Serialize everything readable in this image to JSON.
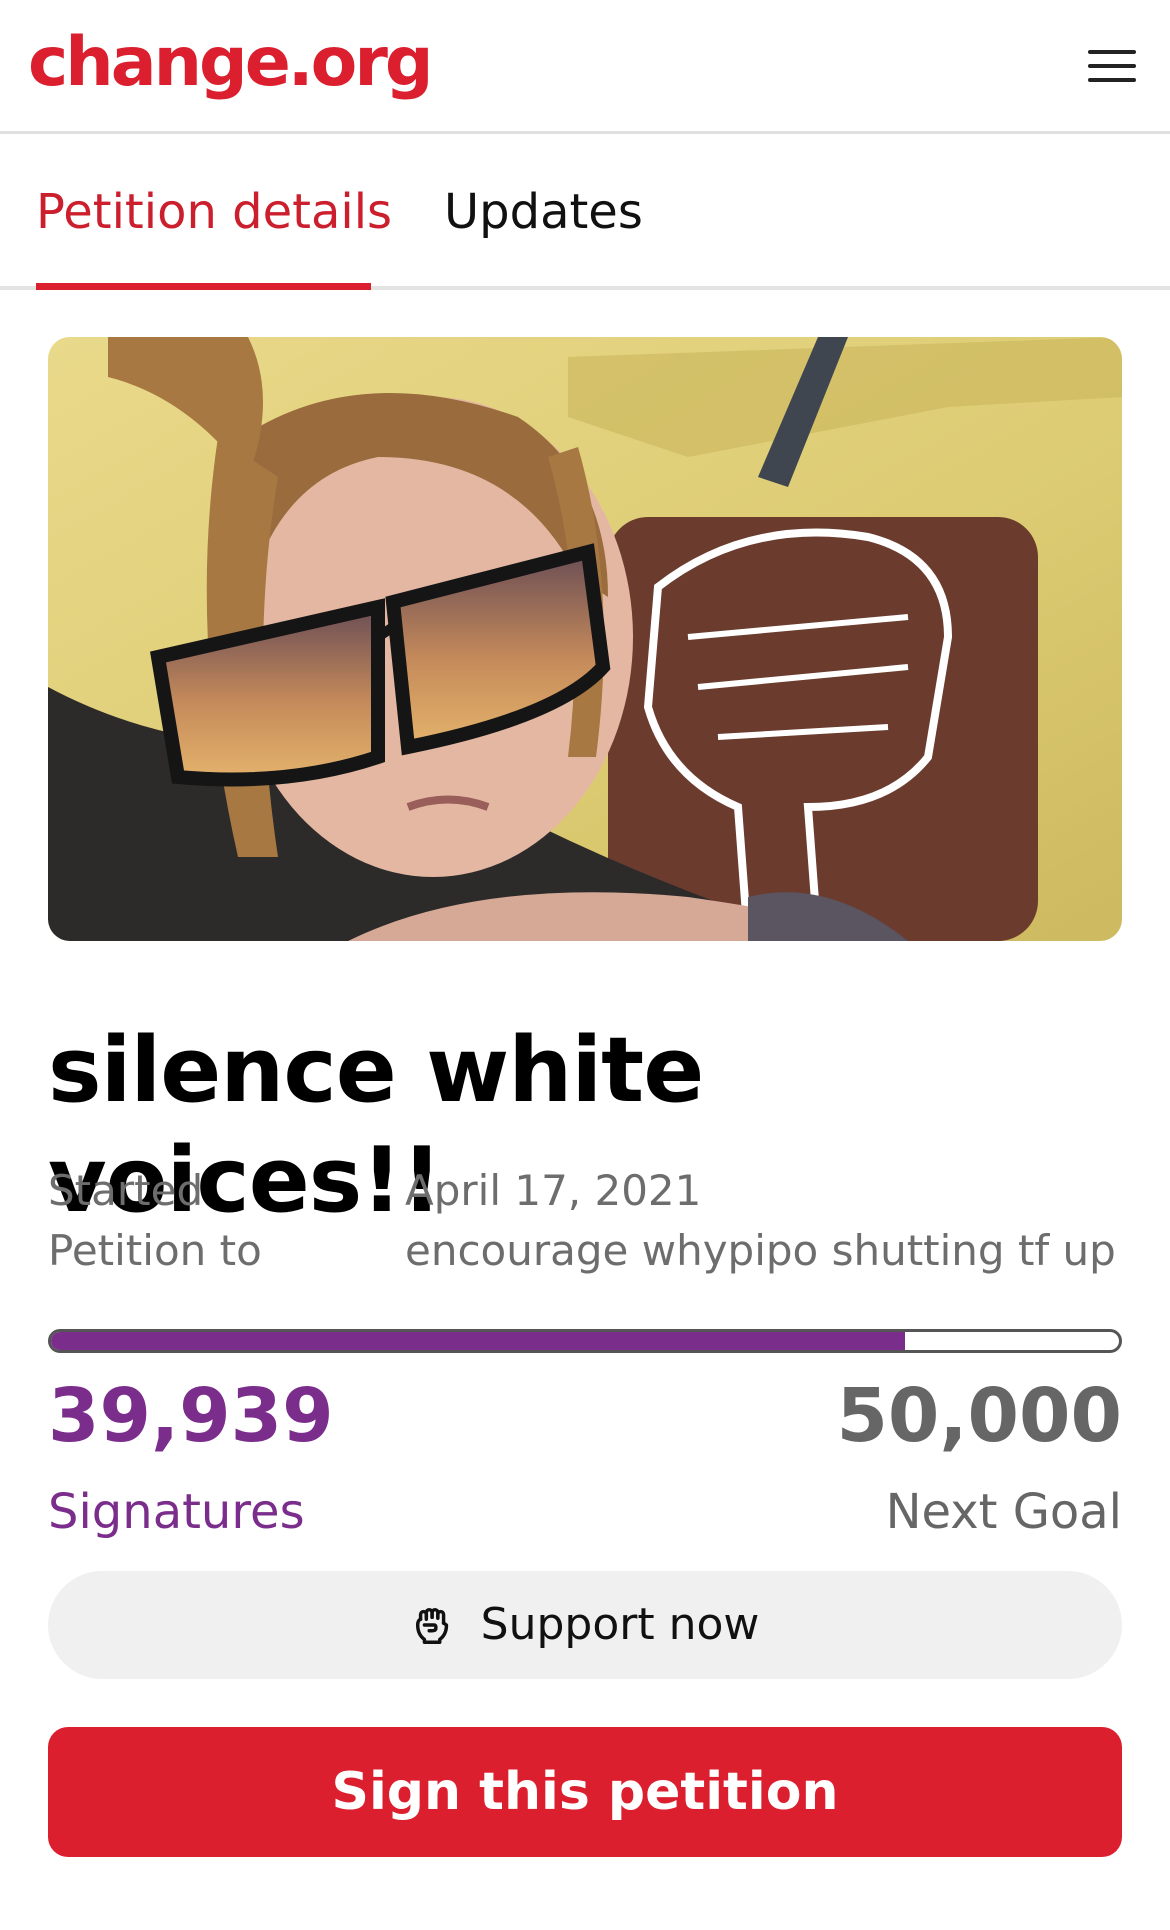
{
  "header": {
    "logo_text": "change.org",
    "menu_icon": "hamburger-menu-icon"
  },
  "tabs": [
    {
      "label": "Petition details",
      "active": true
    },
    {
      "label": "Updates",
      "active": false
    }
  ],
  "petition": {
    "title": "silence white voices!!",
    "started_label": "Started",
    "started_value": "April 17, 2021",
    "petition_to_label": "Petition to",
    "petition_to_value": "encourage whypipo shutting tf up"
  },
  "progress": {
    "signatures": "39,939",
    "signatures_label": "Signatures",
    "goal": "50,000",
    "goal_label": "Next Goal",
    "fraction": 0.8
  },
  "actions": {
    "support_label": "Support now",
    "support_icon": "raised-fist-icon",
    "sign_label": "Sign this petition"
  },
  "colors": {
    "brand_red": "#db1f2e",
    "progress_purple": "#7b2d8b"
  }
}
